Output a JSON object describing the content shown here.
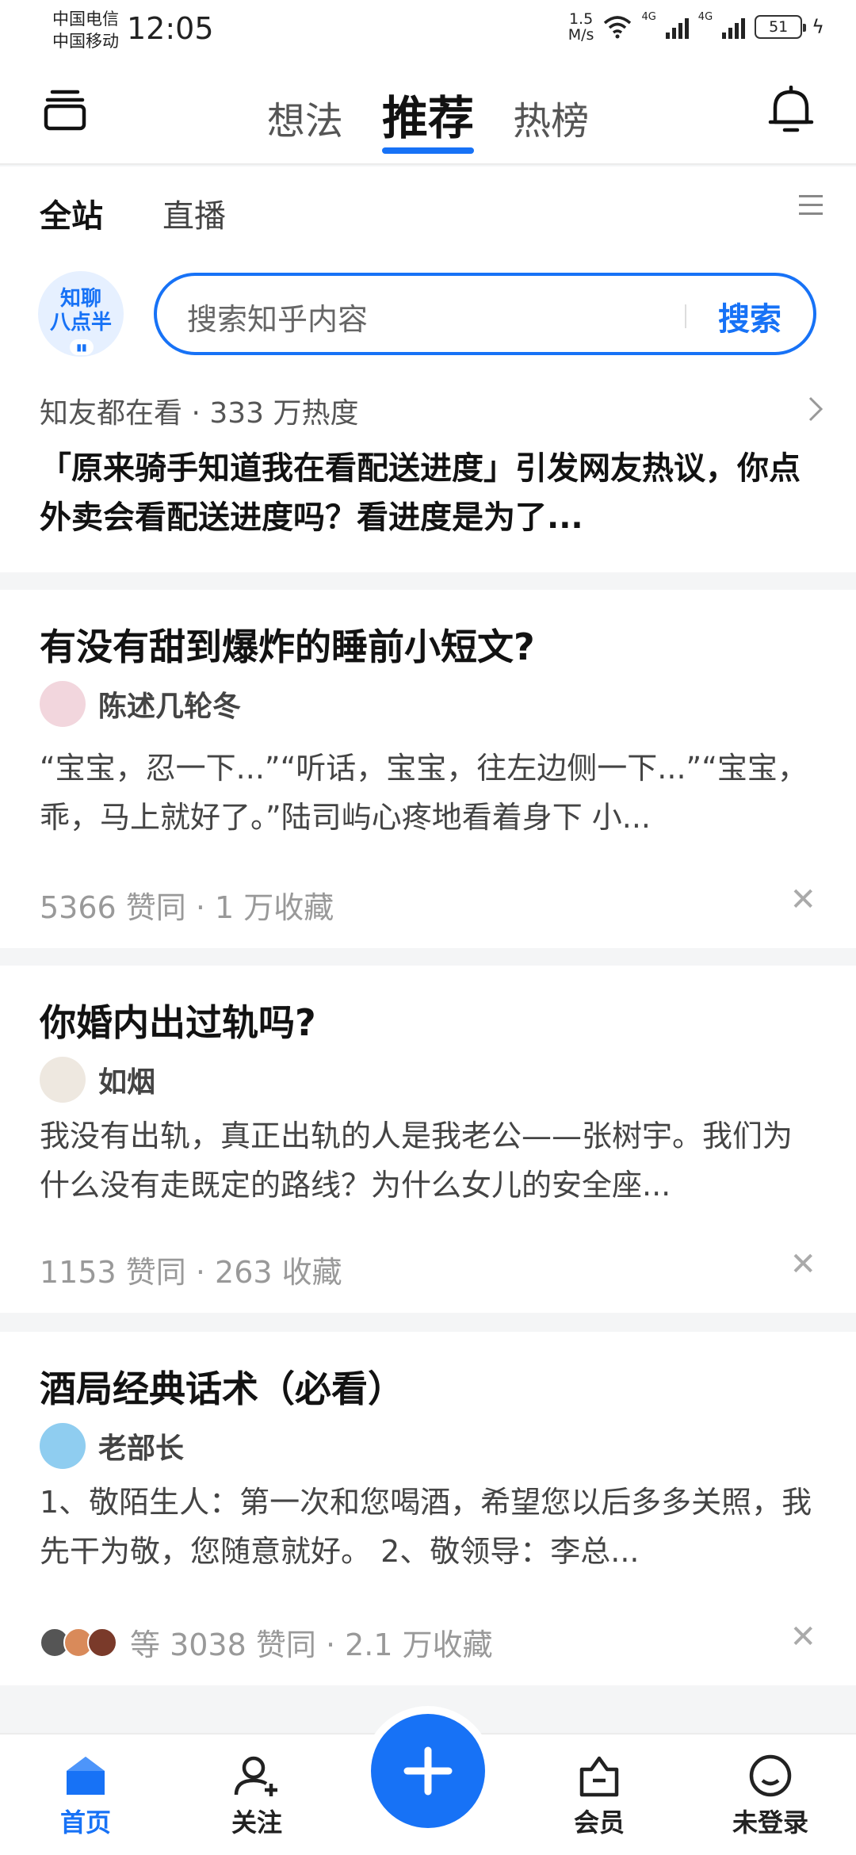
{
  "status_bar": {
    "carrier1": "中国电信",
    "carrier2": "中国移动",
    "time": "12:05",
    "net_speed_value": "1.5",
    "net_speed_unit": "M/s",
    "signal_tag": "4G",
    "battery": "51"
  },
  "top_nav": {
    "tabs": [
      "想法",
      "推荐",
      "热榜"
    ],
    "active_tab": "推荐"
  },
  "channels": {
    "all": "全站",
    "live": "直播"
  },
  "search": {
    "logo_line1": "知聊",
    "logo_line2": "八点半",
    "placeholder": "搜索知乎内容",
    "button": "搜索"
  },
  "hot": {
    "meta": "知友都在看 · 333 万热度",
    "title": "「原来骑手知道我在看配送进度」引发网友热议，你点外卖会看配送进度吗？看进度是为了..."
  },
  "feed": [
    {
      "title": "有没有甜到爆炸的睡前小短文?",
      "author": "陈述几轮冬",
      "excerpt": "“宝宝，忍一下...”“听话，宝宝，往左边侧一下...”“宝宝，乖，马上就好了。”陆司屿心疼地看着身下 小...",
      "stats": "5366 赞同 · 1 万收藏"
    },
    {
      "title": "你婚内出过轨吗?",
      "author": "如烟",
      "excerpt": "我没有出轨，真正出轨的人是我老公——张树宇。我们为什么没有走既定的路线？为什么女儿的安全座...",
      "stats": "1153 赞同 · 263 收藏"
    },
    {
      "title": "酒局经典话术（必看）",
      "author": "老部长",
      "excerpt": "1、敬陌生人：第一次和您喝酒，希望您以后多多关照，我先干为敬，您随意就好。 2、敬领导：李总...",
      "stats": "等 3038 赞同 · 2.1 万收藏"
    }
  ],
  "bottom_nav": {
    "home": "首页",
    "follow": "关注",
    "vip": "会员",
    "profile": "未登录"
  },
  "colors": {
    "accent": "#1772f6",
    "background": "#f4f5f6"
  }
}
